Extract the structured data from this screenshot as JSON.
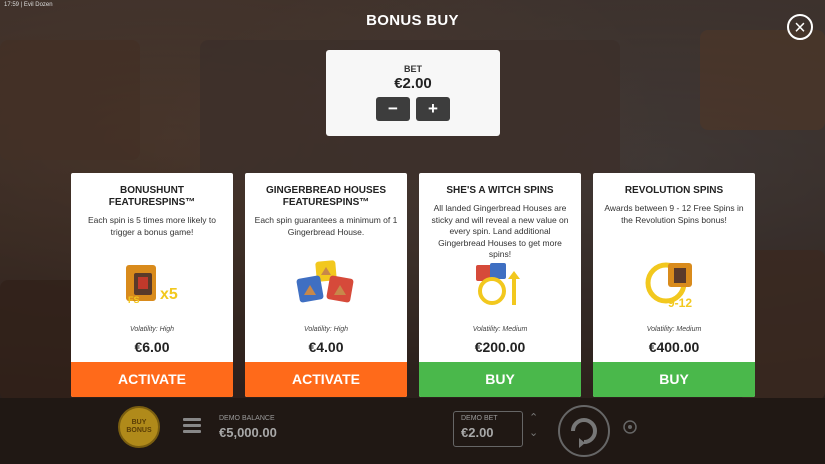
{
  "status_bar": {
    "text": "17:59 | Evil Dozen"
  },
  "header": {
    "title": "BONUS BUY",
    "close_icon": "close-icon"
  },
  "bet_panel": {
    "label": "BET",
    "value": "€2.00",
    "minus": "−",
    "plus": "+"
  },
  "cards": [
    {
      "title": "BONUSHUNT FEATURESPINS™",
      "description": "Each spin is 5 times more likely to trigger a bonus game!",
      "icon": "bonushunt-icon",
      "volatility": "Volatility: High",
      "price": "€6.00",
      "action": "ACTIVATE",
      "action_color": "#ff6a1a"
    },
    {
      "title": "GINGERBREAD HOUSES FEATURESPINS™",
      "description": "Each spin guarantees a minimum of 1 Gingerbread House.",
      "icon": "gingerbread-houses-icon",
      "volatility": "Volatility: High",
      "price": "€4.00",
      "action": "ACTIVATE",
      "action_color": "#ff6a1a"
    },
    {
      "title": "SHE'S A WITCH SPINS",
      "description": "All landed Gingerbread Houses are sticky and will reveal a new value on every spin. Land additional Gingerbread Houses to get more spins!",
      "icon": "witch-spins-icon",
      "volatility": "Volatility: Medium",
      "price": "€200.00",
      "action": "BUY",
      "action_color": "#4ab84b"
    },
    {
      "title": "REVOLUTION SPINS",
      "description": "Awards between 9 - 12 Free Spins in the Revolution Spins bonus!",
      "icon": "revolution-spins-icon",
      "volatility": "Volatility: Medium",
      "price": "€400.00",
      "action": "BUY",
      "action_color": "#4ab84b"
    }
  ],
  "bottom_bar": {
    "buy_bonus": "BUY BONUS",
    "demo_balance_label": "DEMO BALANCE",
    "demo_balance_value": "€5,000.00",
    "demo_bet_label": "DEMO BET",
    "demo_bet_value": "€2.00"
  }
}
